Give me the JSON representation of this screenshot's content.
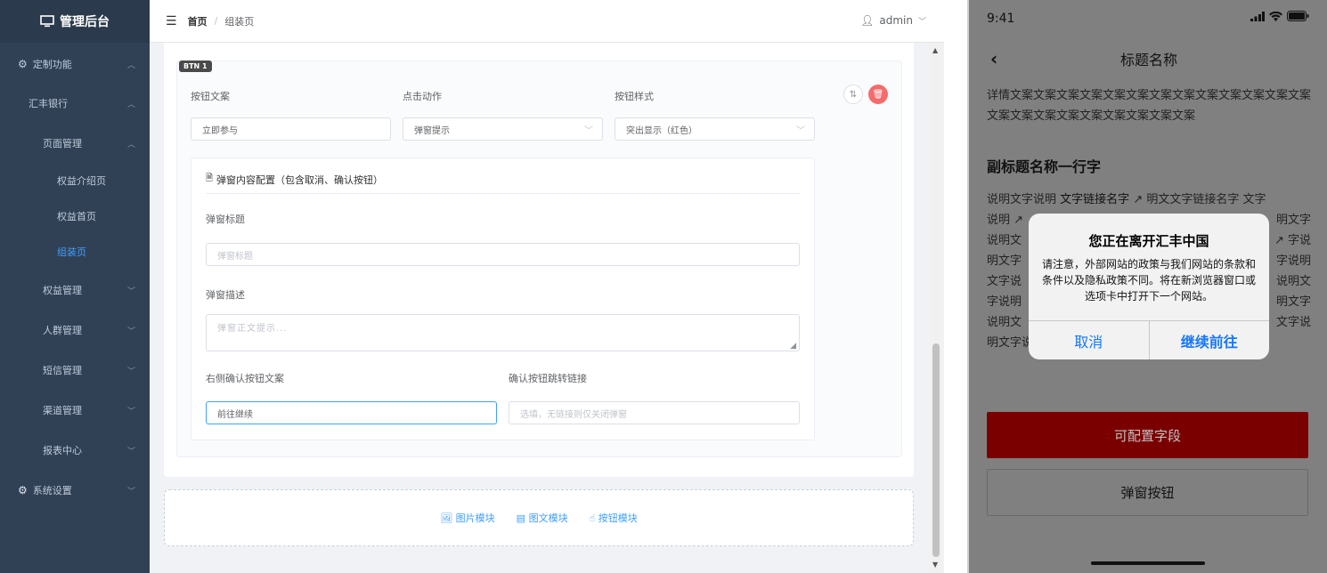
{
  "sidebar": {
    "logo": "管理后台",
    "items": [
      {
        "label": "定制功能"
      },
      {
        "label": "汇丰银行"
      },
      {
        "label": "页面管理"
      },
      {
        "label": "权益介绍页"
      },
      {
        "label": "权益首页"
      },
      {
        "label": "组装页"
      },
      {
        "label": "权益管理"
      },
      {
        "label": "人群管理"
      },
      {
        "label": "短信管理"
      },
      {
        "label": "渠道管理"
      },
      {
        "label": "报表中心"
      },
      {
        "label": "系统设置"
      }
    ]
  },
  "header": {
    "home": "首页",
    "sep": "/",
    "current": "组装页",
    "user": "admin"
  },
  "btn_block": {
    "tag": "BTN 1",
    "label_text": "按钮文案",
    "label_action": "点击动作",
    "label_style": "按钮样式",
    "text_value": "立即参与",
    "action_value": "弹窗提示",
    "style_value": "突出显示（红色）"
  },
  "popup_config": {
    "title": "弹窗内容配置（包含取消、确认按钮）",
    "label_title": "弹窗标题",
    "title_placeholder": "弹窗标题",
    "label_desc": "弹窗描述",
    "desc_placeholder": "弹窗正文提示...",
    "label_confirm": "右侧确认按钮文案",
    "confirm_value": "前往继续",
    "label_link": "确认按钮跳转链接",
    "link_placeholder": "选填，无链接则仅关闭弹窗"
  },
  "add_modules": {
    "image": "图片模块",
    "rich": "图文模块",
    "button": "按钮模块"
  },
  "phone": {
    "time": "9:41",
    "nav_title": "标题名称",
    "detail_text": "详情文案文案文案文案文案文案文案文案文案文案文案文案文案文案文案文案文案文案文案文案文案文案",
    "subtitle": "副标题名称一行字",
    "para": [
      "说明文字说明",
      "文字链接名字",
      "明文文字链接名字 文字",
      "说明",
      "明文字",
      "说明文",
      "字说",
      "明文字",
      "字说明",
      "文字说",
      "说明文",
      "字说明",
      "明文字",
      "说明文",
      "文字说",
      "明文字说明"
    ],
    "btn_primary": "可配置字段",
    "btn_secondary": "弹窗按钮",
    "dialog": {
      "title": "您正在离开汇丰中国",
      "message": "请注意，外部网站的政策与我们网站的条款和条件以及隐私政策不同。将在新浏览器窗口或选项卡中打开下一个网站。",
      "cancel": "取消",
      "confirm": "继续前往"
    }
  }
}
